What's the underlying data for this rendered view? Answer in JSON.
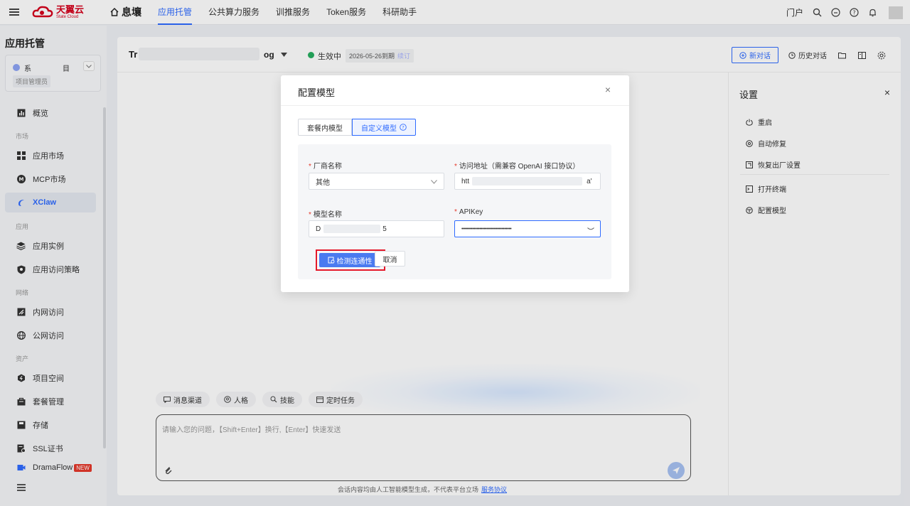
{
  "topbar": {
    "logo_cn": "天翼云",
    "logo_en": "State Cloud",
    "home_label": "息壤",
    "nav": [
      "应用托管",
      "公共算力服务",
      "训推服务",
      "Token服务",
      "科研助手"
    ],
    "portal": "门户"
  },
  "sidebar": {
    "title": "应用托管",
    "project": {
      "name_start": "系",
      "name_end": "目",
      "role": "项目管理员"
    },
    "items": {
      "overview": "概览",
      "group_market": "市场",
      "app_market": "应用市场",
      "mcp_market": "MCP市场",
      "xclaw": "XClaw",
      "group_app": "应用",
      "app_instance": "应用实例",
      "app_access": "应用访问策略",
      "group_network": "网络",
      "intranet": "内网访问",
      "public": "公网访问",
      "group_asset": "资产",
      "project_space": "项目空间",
      "package": "套餐管理",
      "storage": "存储",
      "ssl": "SSL证书",
      "dramaflow": "DramaFlow",
      "new_badge": "NEW"
    }
  },
  "main": {
    "title_start": "Tr",
    "title_end": "og",
    "status": "生效中",
    "expire": "2026-05-26到期",
    "renew": "续订",
    "new_chat": "新对话",
    "history": "历史对话"
  },
  "chat": {
    "chips": [
      "消息渠道",
      "人格",
      "技能",
      "定时任务"
    ],
    "placeholder": "请输入您的问题，【Shift+Enter】换行,【Enter】快速发送",
    "disclaimer": "会话内容均由人工智能模型生成，不代表平台立场",
    "agreement": "服务协议"
  },
  "settings": {
    "title": "设置",
    "items": [
      "重启",
      "自动修复",
      "恢复出厂设置",
      "打开终端",
      "配置模型"
    ]
  },
  "modal": {
    "title": "配置模型",
    "tabs": [
      "套餐内模型",
      "自定义模型"
    ],
    "vendor_label": "厂商名称",
    "vendor_value": "其他",
    "url_label": "访问地址（需兼容 OpenAI 接口协议）",
    "url_value_start": "htt",
    "url_value_end": "a'",
    "model_label": "模型名称",
    "model_value_start": "D",
    "model_value_end": "5",
    "apikey_label": "APIKey",
    "apikey_value": "••••••••••••••••••••••••••••••••••••",
    "check_button": "检测连通性",
    "cancel_button": "取消"
  },
  "colors": {
    "accent": "#2f6bff",
    "brand": "#d6001c",
    "highlight": "#e5192b",
    "status": "#27ae60"
  }
}
